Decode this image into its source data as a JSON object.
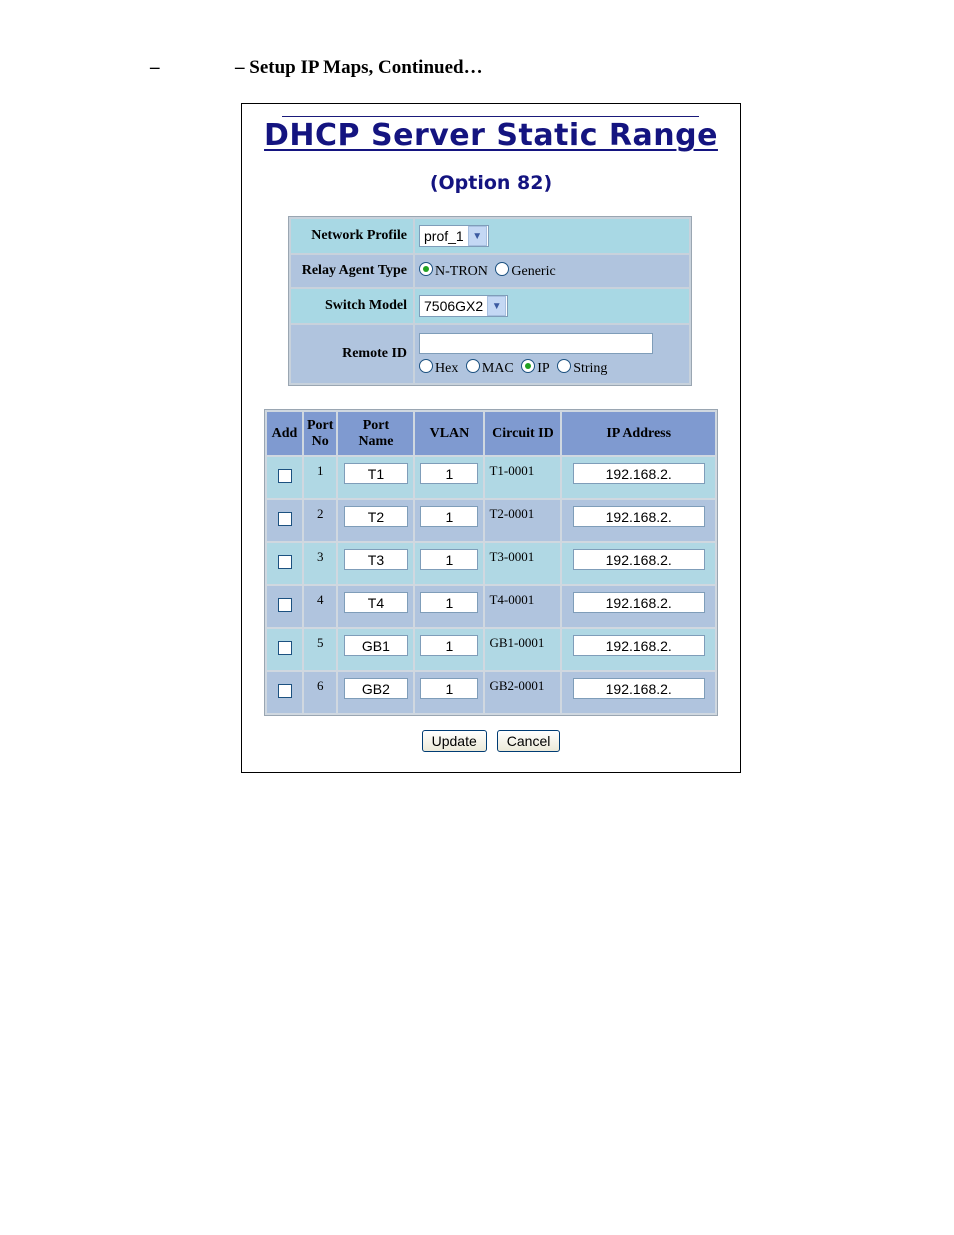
{
  "doc_header": {
    "dash": "–",
    "title": "– Setup IP Maps, Continued…"
  },
  "page": {
    "title": "DHCP Server Static Range",
    "subtitle": "(Option 82)"
  },
  "settings": {
    "network_profile": {
      "label": "Network Profile",
      "value": "prof_1"
    },
    "relay_agent_type": {
      "label": "Relay Agent Type",
      "options": [
        "N-TRON",
        "Generic"
      ],
      "selected": "N-TRON"
    },
    "switch_model": {
      "label": "Switch Model",
      "value": "7506GX2"
    },
    "remote_id": {
      "label": "Remote ID",
      "value": "",
      "options": [
        "Hex",
        "MAC",
        "IP",
        "String"
      ],
      "selected": "IP"
    }
  },
  "ports_table": {
    "headers": {
      "add": "Add",
      "port_no_1": "Port",
      "port_no_2": "No",
      "port_name_1": "Port",
      "port_name_2": "Name",
      "vlan": "VLAN",
      "circuit_id": "Circuit ID",
      "ip_address": "IP Address"
    },
    "rows": [
      {
        "no": "1",
        "name": "T1",
        "vlan": "1",
        "circuit": "T1-0001",
        "ip": "192.168.2."
      },
      {
        "no": "2",
        "name": "T2",
        "vlan": "1",
        "circuit": "T2-0001",
        "ip": "192.168.2."
      },
      {
        "no": "3",
        "name": "T3",
        "vlan": "1",
        "circuit": "T3-0001",
        "ip": "192.168.2."
      },
      {
        "no": "4",
        "name": "T4",
        "vlan": "1",
        "circuit": "T4-0001",
        "ip": "192.168.2."
      },
      {
        "no": "5",
        "name": "GB1",
        "vlan": "1",
        "circuit": "GB1-0001",
        "ip": "192.168.2."
      },
      {
        "no": "6",
        "name": "GB2",
        "vlan": "1",
        "circuit": "GB2-0001",
        "ip": "192.168.2."
      }
    ]
  },
  "buttons": {
    "update": "Update",
    "cancel": "Cancel"
  }
}
